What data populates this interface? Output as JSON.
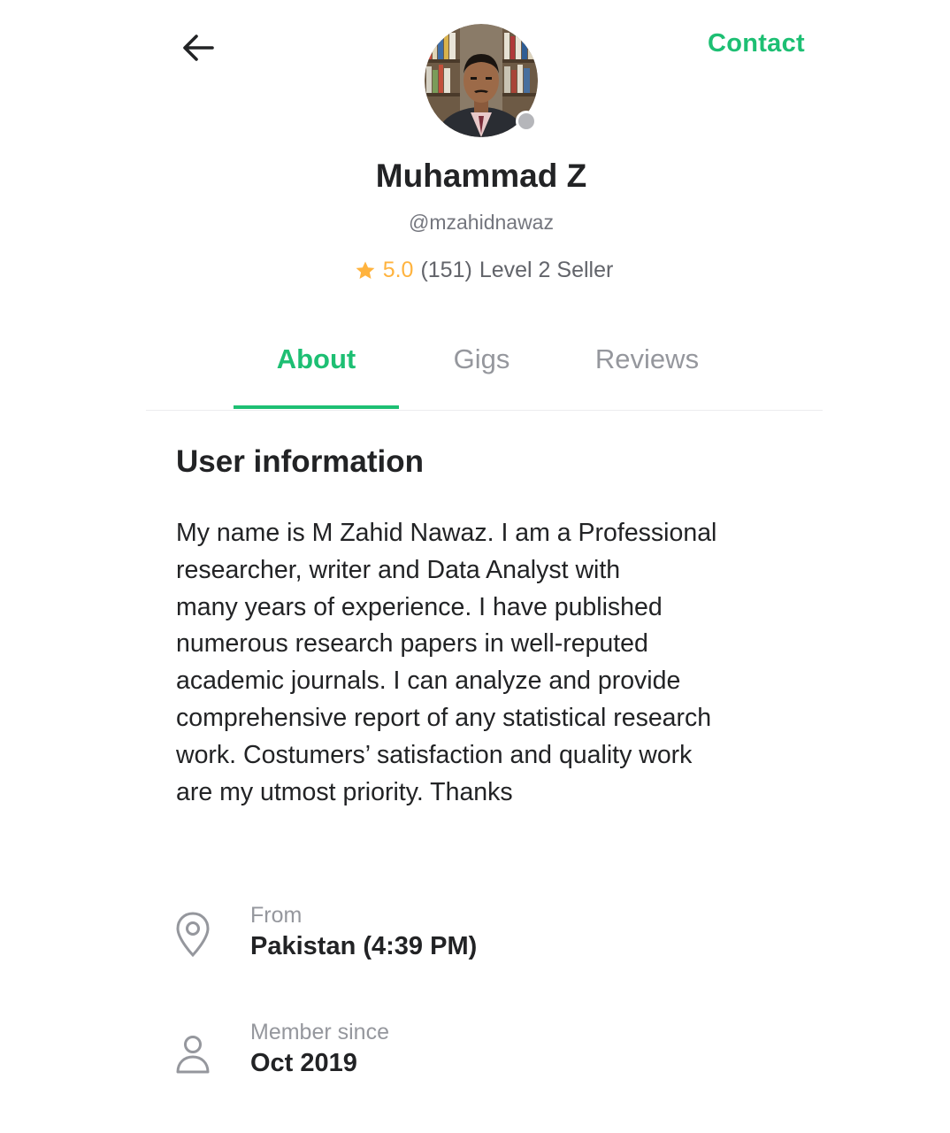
{
  "header": {
    "back_icon": "arrow-left-icon",
    "contact_label": "Contact"
  },
  "profile": {
    "display_name": "Muhammad Z",
    "username": "@mzahidnawaz",
    "rating": "5.0",
    "review_count": "(151)",
    "level": "Level 2 Seller",
    "star_icon": "star-icon",
    "online_status_color": "#b5b6ba"
  },
  "tabs": [
    {
      "label": "About",
      "active": true
    },
    {
      "label": "Gigs",
      "active": false
    },
    {
      "label": "Reviews",
      "active": false
    }
  ],
  "about": {
    "section_title": "User information",
    "bio_lines": [
      "My name is M Zahid Nawaz. I am a Professional",
      "researcher, writer and Data Analyst with",
      "many years of experience. I have published",
      "numerous research papers in well-reputed",
      "academic journals. I can analyze and provide",
      "comprehensive report of any statistical research",
      "work. Costumers’ satisfaction and quality work",
      "are my utmost priority. Thanks"
    ],
    "from": {
      "icon": "location-pin-icon",
      "label": "From",
      "value": "Pakistan (4:39 PM)"
    },
    "member_since": {
      "icon": "user-icon",
      "label": "Member since",
      "value": "Oct 2019"
    }
  },
  "colors": {
    "accent": "#1dbf73",
    "star": "#ffb33e",
    "muted_text": "#95979d",
    "primary_text": "#222325"
  }
}
